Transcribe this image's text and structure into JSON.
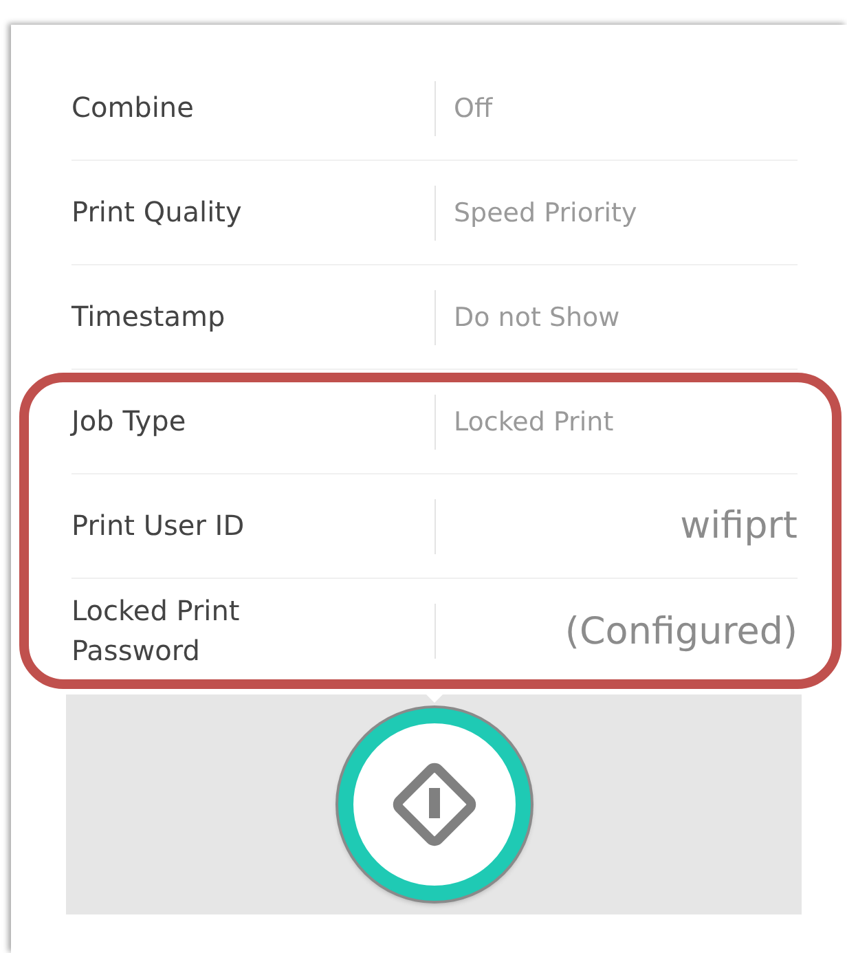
{
  "settings": [
    {
      "label": "Combine",
      "value": "Off",
      "kind": "choice",
      "highlighted": false
    },
    {
      "label": "Print Quality",
      "value": "Speed Priority",
      "kind": "choice",
      "highlighted": false
    },
    {
      "label": "Timestamp",
      "value": "Do not Show",
      "kind": "choice",
      "highlighted": false
    },
    {
      "label": "Job Type",
      "value": "Locked Print",
      "kind": "choice",
      "highlighted": true
    },
    {
      "label": "Print User ID",
      "value": "wifiprt",
      "kind": "entry",
      "highlighted": true
    },
    {
      "label": "Locked Print Password",
      "value": "(Configured)",
      "kind": "entry",
      "highlighted": true
    }
  ],
  "start_button": {
    "kind": "start"
  }
}
